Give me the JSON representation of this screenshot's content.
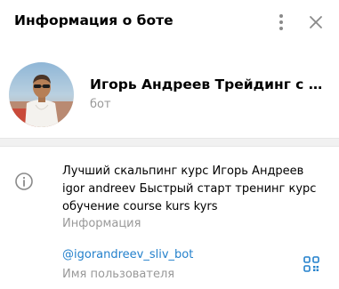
{
  "header": {
    "title": "Информация о боте",
    "menu_icon": "more-vertical-icon",
    "close_icon": "close-icon"
  },
  "profile": {
    "name": "Игорь Андреев Трейдинг с нул...",
    "status": "бот"
  },
  "info": {
    "icon": "info-icon",
    "bio": "Лучший скальпинг курс Игорь Андреев igor andreev Быстрый старт тренинг курс обучение course kurs kyrs",
    "bio_label": "Информация"
  },
  "username": {
    "value": "@igorandreev_sliv_bot",
    "label": "Имя пользователя",
    "qr_icon": "qr-code-icon"
  },
  "colors": {
    "link": "#2481cc",
    "secondary_text": "#999999",
    "icon": "#8a8a8a"
  }
}
